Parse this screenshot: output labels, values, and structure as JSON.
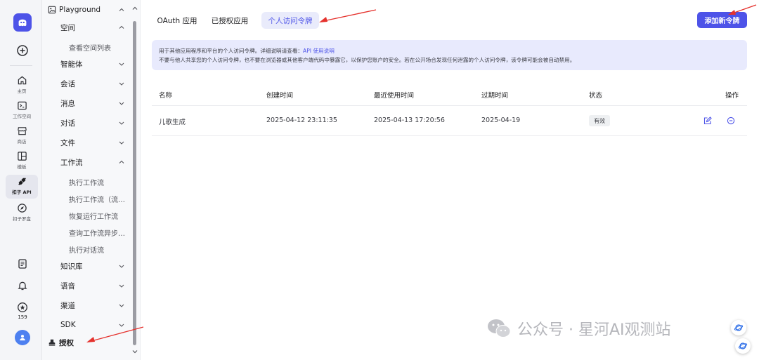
{
  "rail": {
    "items": [
      {
        "label": "主页",
        "icon": "home-icon"
      },
      {
        "label": "工作空间",
        "icon": "terminal-icon"
      },
      {
        "label": "商店",
        "icon": "store-icon"
      },
      {
        "label": "模板",
        "icon": "template-icon"
      },
      {
        "label": "扣子 API",
        "icon": "api-icon",
        "active": true
      },
      {
        "label": "扣子罗盘",
        "icon": "compass-icon"
      }
    ],
    "star_count": "159"
  },
  "menu": {
    "top_item": "Playground",
    "items": [
      {
        "label": "空间",
        "level": 1,
        "expanded": true
      },
      {
        "label": "查看空间列表",
        "level": 2
      },
      {
        "label": "智能体",
        "level": 1
      },
      {
        "label": "会话",
        "level": 1
      },
      {
        "label": "消息",
        "level": 1
      },
      {
        "label": "对话",
        "level": 1
      },
      {
        "label": "文件",
        "level": 1
      },
      {
        "label": "工作流",
        "level": 1,
        "expanded": true
      },
      {
        "label": "执行工作流",
        "level": 2
      },
      {
        "label": "执行工作流（流…",
        "level": 2
      },
      {
        "label": "恢复运行工作流",
        "level": 2
      },
      {
        "label": "查询工作流异步…",
        "level": 2
      },
      {
        "label": "执行对话流",
        "level": 2
      },
      {
        "label": "知识库",
        "level": 1
      },
      {
        "label": "语音",
        "level": 1
      },
      {
        "label": "渠道",
        "level": 1
      },
      {
        "label": "SDK",
        "level": 1
      }
    ],
    "auth_item": "授权"
  },
  "tabs": [
    {
      "label": "OAuth 应用"
    },
    {
      "label": "已授权应用"
    },
    {
      "label": "个人访问令牌",
      "active": true
    }
  ],
  "add_token_button": "添加新令牌",
  "banner": {
    "line1_prefix": "用于其他应用程序和平台的个人访问令牌。详细说明请查看：",
    "line1_link": "API 使用说明",
    "line2": "不要与他人共享您的个人访问令牌，也不要在浏览器或其他客户端代码中暴露它，以保护您账户的安全。若在公开场合发现任何泄露的个人访问令牌，该令牌可能会被自动禁用。"
  },
  "table": {
    "columns": [
      "名称",
      "创建时间",
      "最近使用时间",
      "过期时间",
      "状态",
      "操作"
    ],
    "rows": [
      {
        "name": "儿歌生成",
        "created": "2025-04-12 23:11:35",
        "last_used": "2025-04-13 17:20:56",
        "expires": "2025-04-19",
        "status": "有效"
      }
    ]
  },
  "watermark": "公众号 · 星河AI观测站",
  "colors": {
    "accent": "#4d53e8",
    "banner_bg": "#e8eafd",
    "annotation": "#e5322d"
  }
}
